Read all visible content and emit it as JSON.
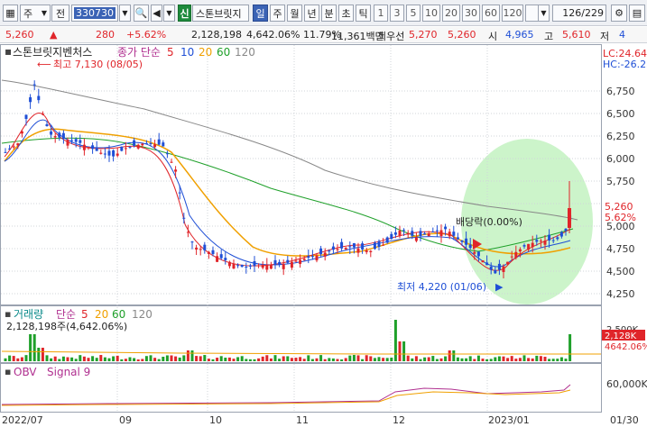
{
  "toolbar": {
    "mode": "주",
    "all_btn": "전",
    "code": "330730",
    "market_badge": "신",
    "stock_name": "스톤브릿지",
    "period_tabs": [
      "일",
      "주",
      "월",
      "년",
      "분",
      "초",
      "틱"
    ],
    "interval_tabs": [
      "1",
      "3",
      "5",
      "10",
      "20",
      "30",
      "60",
      "120"
    ],
    "page_count": "126",
    "page_total": "/229"
  },
  "quote": {
    "price": "5,260",
    "change": "280",
    "change_pct": "+5.62%",
    "volume": "2,128,198",
    "volume_ratio": "4,642.06%",
    "turnover": "11.79%",
    "amount": "11,361백만",
    "best_ask_label": "최우선",
    "best_ask": "5,270",
    "best_bid": "5,260",
    "open_label": "시",
    "open": "4,965",
    "high_label": "고",
    "high": "5,610",
    "low_label": "저",
    "low": "4"
  },
  "price_panel": {
    "legend_name": "스톤브릿지벤처스",
    "legend_ma": "종가 단순",
    "ma_periods": [
      "5",
      "10",
      "20",
      "60",
      "120"
    ],
    "ma_colors": [
      "#e0252a",
      "#1f4fd6",
      "#f0a000",
      "#1fa02a",
      "#888888"
    ],
    "high_note": "최고 7,130 (08/05)",
    "low_note": "최저 4,220 (01/06)",
    "dividend_note": "배당락(0.00%)",
    "lc": "LC:24.64",
    "hc": "HC:-26.23",
    "y_ticks": [
      "6,750",
      "6,500",
      "6,250",
      "6,000",
      "5,750",
      "5,500",
      "5,250",
      "5,000",
      "4,750",
      "4,500",
      "4,250"
    ],
    "last_price_tag": "5,260",
    "last_pct_tag": "5.62%"
  },
  "volume_panel": {
    "legend_name": "거래량",
    "legend_ma": "단순",
    "ma_periods": [
      "5",
      "20",
      "60",
      "120"
    ],
    "value_text": "2,128,198주(4,642.06%)",
    "y_tick": "2,500K",
    "tag_value": "2,128K",
    "tag_pct": "4642.06%"
  },
  "obv_panel": {
    "legend_name": "OBV",
    "legend_signal": "Signal 9",
    "y_tick": "60,000K"
  },
  "x_axis": [
    "2022/07",
    "09",
    "10",
    "11",
    "12",
    "2023/01",
    "01/30"
  ],
  "colors": {
    "up": "#e0252a",
    "down": "#1f4fd6",
    "highlight": "#8ee68a"
  },
  "chart_data": {
    "type": "line",
    "title": "스톤브릿지벤처스",
    "x": [
      "2022/07",
      "09",
      "10",
      "11",
      "12",
      "2023/01"
    ],
    "series": [
      {
        "name": "종가",
        "values": [
          6000,
          5800,
          4600,
          4700,
          4900,
          5260
        ]
      }
    ],
    "ylim": [
      4100,
      7000
    ]
  }
}
